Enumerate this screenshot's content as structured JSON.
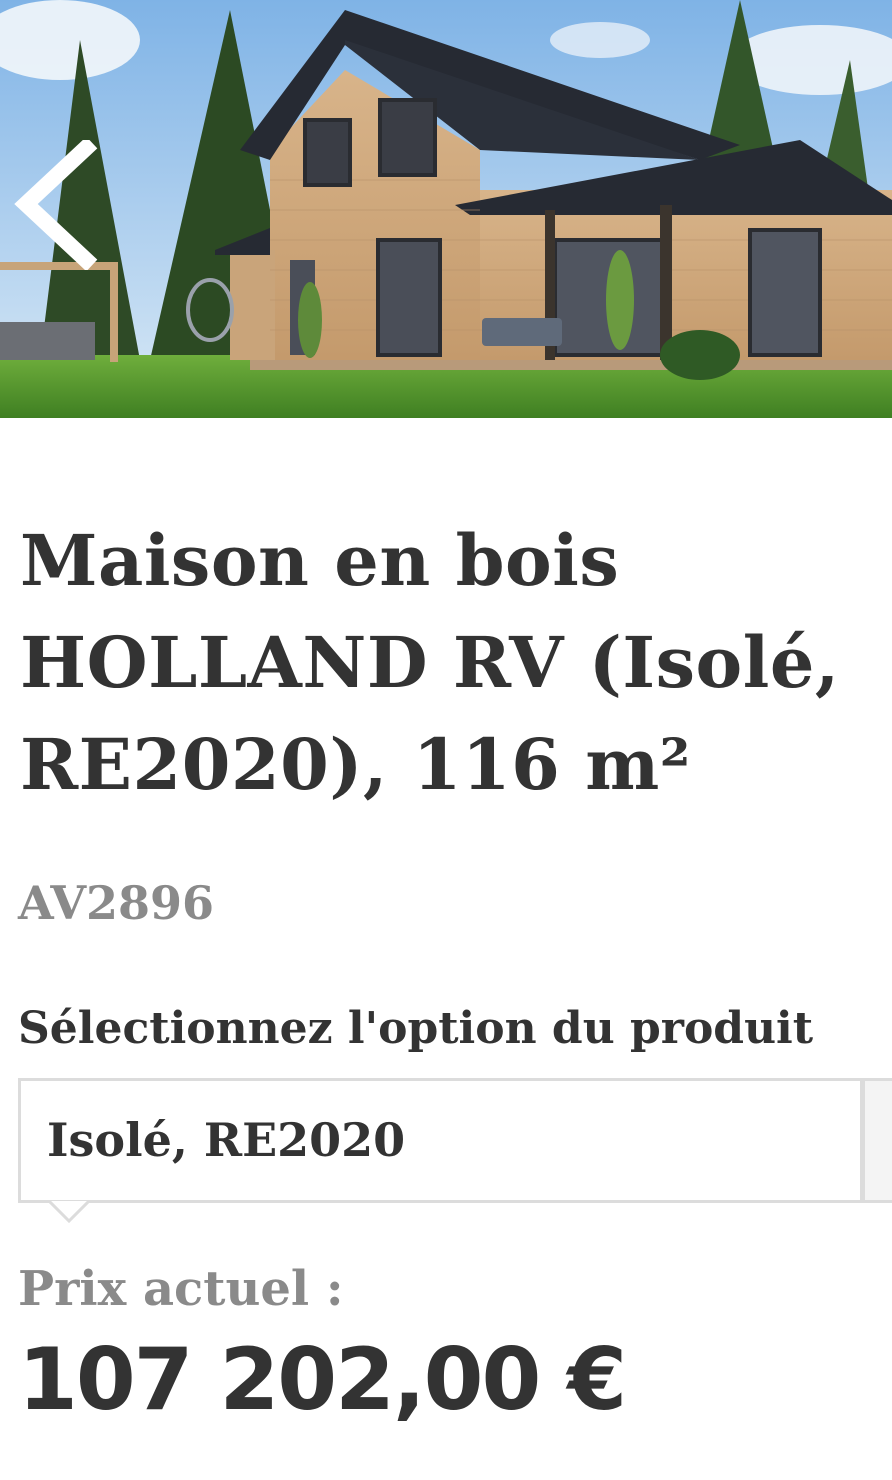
{
  "hero": {
    "image_alt": "house-photo",
    "prev_icon": "chevron-left-icon"
  },
  "product": {
    "title": "Maison en bois HOLLAND RV (Isolé, RE2020), 116 m²",
    "sku": "AV2896"
  },
  "option": {
    "label": "Sélectionnez l'option du produit",
    "selected": "Isolé, RE2020"
  },
  "pricing": {
    "label": "Prix actuel :",
    "value": "107 202,00  €"
  },
  "colors": {
    "text": "#333333",
    "muted": "#8a8a8a",
    "border": "#dcdcdc"
  }
}
